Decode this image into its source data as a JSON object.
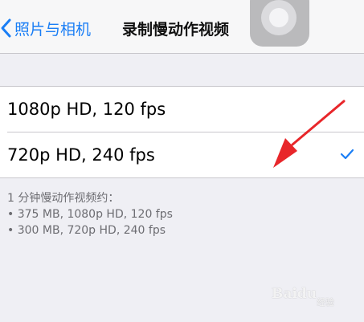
{
  "navbar": {
    "back_label": "照片与相机",
    "title": "录制慢动作视频"
  },
  "options": [
    {
      "label": "1080p HD, 120 fps",
      "selected": false
    },
    {
      "label": "720p HD, 240 fps",
      "selected": true
    }
  ],
  "footer": {
    "heading": "1 分钟慢动作视频约：",
    "lines": [
      "• 375 MB, 1080p HD, 120 fps",
      "• 300 MB, 720p HD, 240 fps"
    ]
  },
  "watermark": {
    "brand": "Baidu",
    "sub": "经验"
  },
  "colors": {
    "accent": "#1a7ef5",
    "background": "#efeff4",
    "annotation_arrow": "#e8262a"
  },
  "icons": {
    "back": "chevron-left-icon",
    "selected": "checkmark-icon",
    "assistive_touch": "assistive-touch-icon"
  }
}
